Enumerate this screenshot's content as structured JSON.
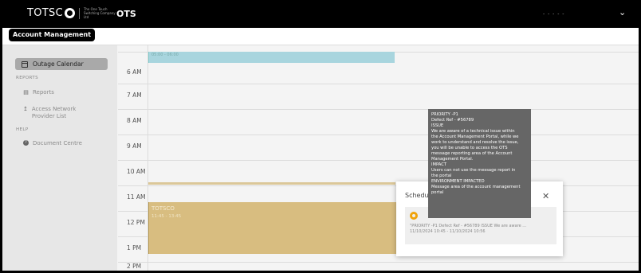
{
  "header": {
    "logo_text": "TOTSC",
    "logo_subtext": "The One Touch Switching Company Ltd",
    "app_title": "OTS",
    "user_name": "- - - - -",
    "user_menu_chevron": "chevron-down-icon"
  },
  "subbar": {
    "account_button": "Account Management"
  },
  "sidebar": {
    "active_item": {
      "label": "Outage Calendar",
      "icon": "calendar-icon"
    },
    "reports_heading": "REPORTS",
    "reports_items": [
      {
        "label": "Reports",
        "icon": "bar-chart-icon"
      },
      {
        "label": "Access Network Provider List",
        "icon": "upload-icon"
      }
    ],
    "help_heading": "HELP",
    "help_items": [
      {
        "label": "Document Centre",
        "icon": "question-icon"
      }
    ]
  },
  "calendar": {
    "hours": [
      "6 AM",
      "7 AM",
      "8 AM",
      "9 AM",
      "10 AM",
      "11 AM",
      "12 PM",
      "1 PM",
      "2 PM"
    ],
    "event_top_time": "05:00 - 06:00",
    "event_main_title": "TOTSCO",
    "event_main_time": "11:45 - 13:45"
  },
  "popup": {
    "title": "Schedu",
    "close_icon": "close-icon",
    "item_icon": "warning-icon",
    "item_text": "\"PRIORITY -P1 Defect Ref - #56789 ISSUE We are aware ...",
    "item_dates": "11/10/2024 10:45 - 11/10/2024 10:56"
  },
  "tooltip": {
    "lines": [
      "PRIORITY -P1",
      "Defect Ref - #56789",
      "ISSUE",
      "We are aware of a technical issue within",
      "the Account Management Portal, while we",
      "work to understand and resolve the issue,",
      "you will be unable to access the OTS",
      "message reporting area of the Account",
      "Management Portal.",
      "IMPACT",
      "Users can not use the message report in",
      "the portal",
      "ENVIRONMENT IMPACTED",
      "Message area of the account management",
      "portal"
    ]
  }
}
